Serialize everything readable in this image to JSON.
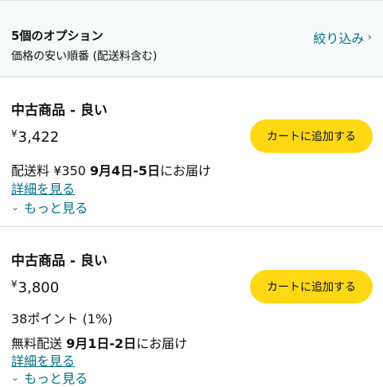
{
  "header": {
    "options_title": "5個のオプション",
    "sort_label": "価格の安い順番 (配送料含む)",
    "filter_label": "絞り込み",
    "filter_icon": "chevron-right-icon"
  },
  "offers": [
    {
      "condition": "中古商品 - 良い",
      "currency": "¥",
      "price": "3,422",
      "cart_label": "カートに追加する",
      "shipping_prefix": "配送料 ¥350 ",
      "delivery_date": "9月4日-5日",
      "delivery_suffix": "にお届け",
      "details_link": "詳細を見る",
      "more_label": "もっと見る",
      "more_icon": "chevron-down-icon"
    },
    {
      "condition": "中古商品 - 良い",
      "currency": "¥",
      "price": "3,800",
      "points": "38ポイント (1%)",
      "cart_label": "カートに追加する",
      "shipping_prefix": "無料配送 ",
      "delivery_date": "9月1日-2日",
      "delivery_suffix": "にお届け",
      "details_link": "詳細を見る",
      "more_label": "もっと見る",
      "more_icon": "chevron-down-icon"
    }
  ],
  "colors": {
    "link": "#007185",
    "cart_button": "#ffd814",
    "header_bg": "#f7fafa"
  }
}
